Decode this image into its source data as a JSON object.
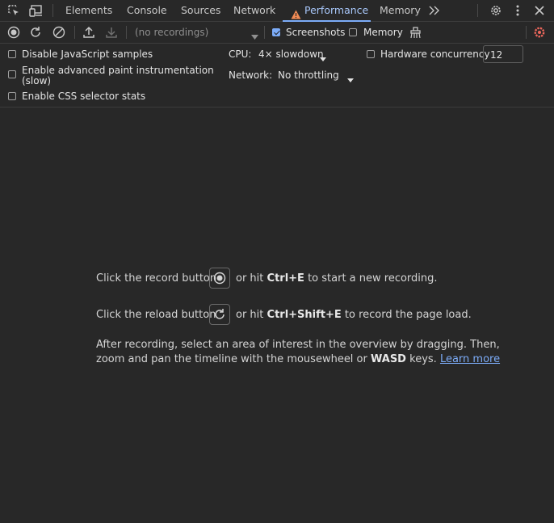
{
  "tabs": [
    {
      "label": "Elements"
    },
    {
      "label": "Console"
    },
    {
      "label": "Sources"
    },
    {
      "label": "Network"
    },
    {
      "label": "Performance",
      "active": true,
      "warning": true
    },
    {
      "label": "Memory"
    }
  ],
  "toolbar": {
    "recordings_placeholder": "(no recordings)",
    "screenshots_label": "Screenshots",
    "screenshots_checked": true,
    "memory_label": "Memory",
    "memory_checked": false
  },
  "settings": {
    "disable_js_samples": "Disable JavaScript samples",
    "advanced_paint_line1": "Enable advanced paint instrumentation",
    "advanced_paint_line2": "(slow)",
    "css_selector_stats": "Enable CSS selector stats",
    "cpu_label": "CPU:",
    "cpu_value": "4× slowdown",
    "network_label": "Network:",
    "network_value": "No throttling",
    "hw_concurrency_label": "Hardware concurrency",
    "hw_concurrency_value": "12"
  },
  "landing": {
    "record_pre": "Click the record button",
    "record_or": "or hit",
    "record_key": "Ctrl+E",
    "record_post": "to start a new recording.",
    "reload_pre": "Click the reload button",
    "reload_or": "or hit",
    "reload_key": "Ctrl+Shift+E",
    "reload_post": "to record the page load.",
    "after_line1": "After recording, select an area of interest in the overview by dragging. Then,",
    "after_line2_pre": "zoom and pan the timeline with the mousewheel or",
    "after_key": "WASD",
    "after_line2_post": "keys.",
    "learn_more": "Learn more"
  },
  "colors": {
    "background": "#282828",
    "accent": "#7cacf8",
    "warning": "#f28b54",
    "settings_gear_active": "#ee675c"
  }
}
